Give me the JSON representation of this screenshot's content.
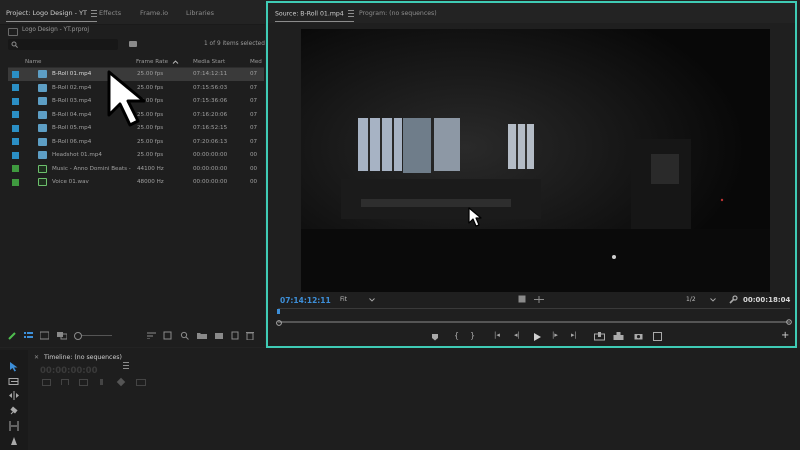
{
  "project_panel": {
    "tabs": [
      {
        "label": "Project: Logo Design - YT",
        "active": true
      },
      {
        "label": "Effects"
      },
      {
        "label": "Frame.io"
      },
      {
        "label": "Libraries"
      }
    ],
    "project_file": "Logo Design - YT.prproj",
    "item_count": "1 of 9 items selected",
    "columns": [
      "Name",
      "Frame Rate",
      "Media Start",
      "Med"
    ],
    "items": [
      {
        "name": "B-Roll 01.mp4",
        "frame_rate": "25.00 fps",
        "media_start": "07:14:12:11",
        "extra": "07",
        "color": "#2b8fc5",
        "type": "video",
        "selected": true
      },
      {
        "name": "B-Roll 02.mp4",
        "frame_rate": "25.00 fps",
        "media_start": "07:15:56:03",
        "extra": "07",
        "color": "#2b8fc5",
        "type": "video"
      },
      {
        "name": "B-Roll 03.mp4",
        "frame_rate": "25.00 fps",
        "media_start": "07:15:36:06",
        "extra": "07",
        "color": "#2b8fc5",
        "type": "video"
      },
      {
        "name": "B-Roll 04.mp4",
        "frame_rate": "25.00 fps",
        "media_start": "07:16:20:06",
        "extra": "07",
        "color": "#2b8fc5",
        "type": "video"
      },
      {
        "name": "B-Roll 05.mp4",
        "frame_rate": "25.00 fps",
        "media_start": "07:16:52:15",
        "extra": "07",
        "color": "#2b8fc5",
        "type": "video"
      },
      {
        "name": "B-Roll 06.mp4",
        "frame_rate": "25.00 fps",
        "media_start": "07:20:06:13",
        "extra": "07",
        "color": "#2b8fc5",
        "type": "video"
      },
      {
        "name": "Headshot 01.mp4",
        "frame_rate": "25.00 fps",
        "media_start": "00:00:00:00",
        "extra": "00",
        "color": "#2b8fc5",
        "type": "video"
      },
      {
        "name": "Music - Anno Domini Beats -",
        "frame_rate": "44100 Hz",
        "media_start": "00:00:00:00",
        "extra": "00",
        "color": "#3f9a3f",
        "type": "audio"
      },
      {
        "name": "Voice 01.wav",
        "frame_rate": "48000 Hz",
        "media_start": "00:00:00:00",
        "extra": "00",
        "color": "#3f9a3f",
        "type": "audio"
      }
    ]
  },
  "source_monitor": {
    "tabs": [
      {
        "label": "Source: B-Roll 01.mp4",
        "active": true
      },
      {
        "label": "Program: (no sequences)"
      }
    ],
    "timecode": "07:14:12:11",
    "fit": "Fit",
    "resolution": "1/2",
    "duration": "00:00:18:04",
    "accent_color": "#3fcbb5",
    "timecode_color": "#3d8fd9"
  },
  "timeline": {
    "title": "Timeline: (no sequences)",
    "timecode": "00:00:00:00"
  }
}
